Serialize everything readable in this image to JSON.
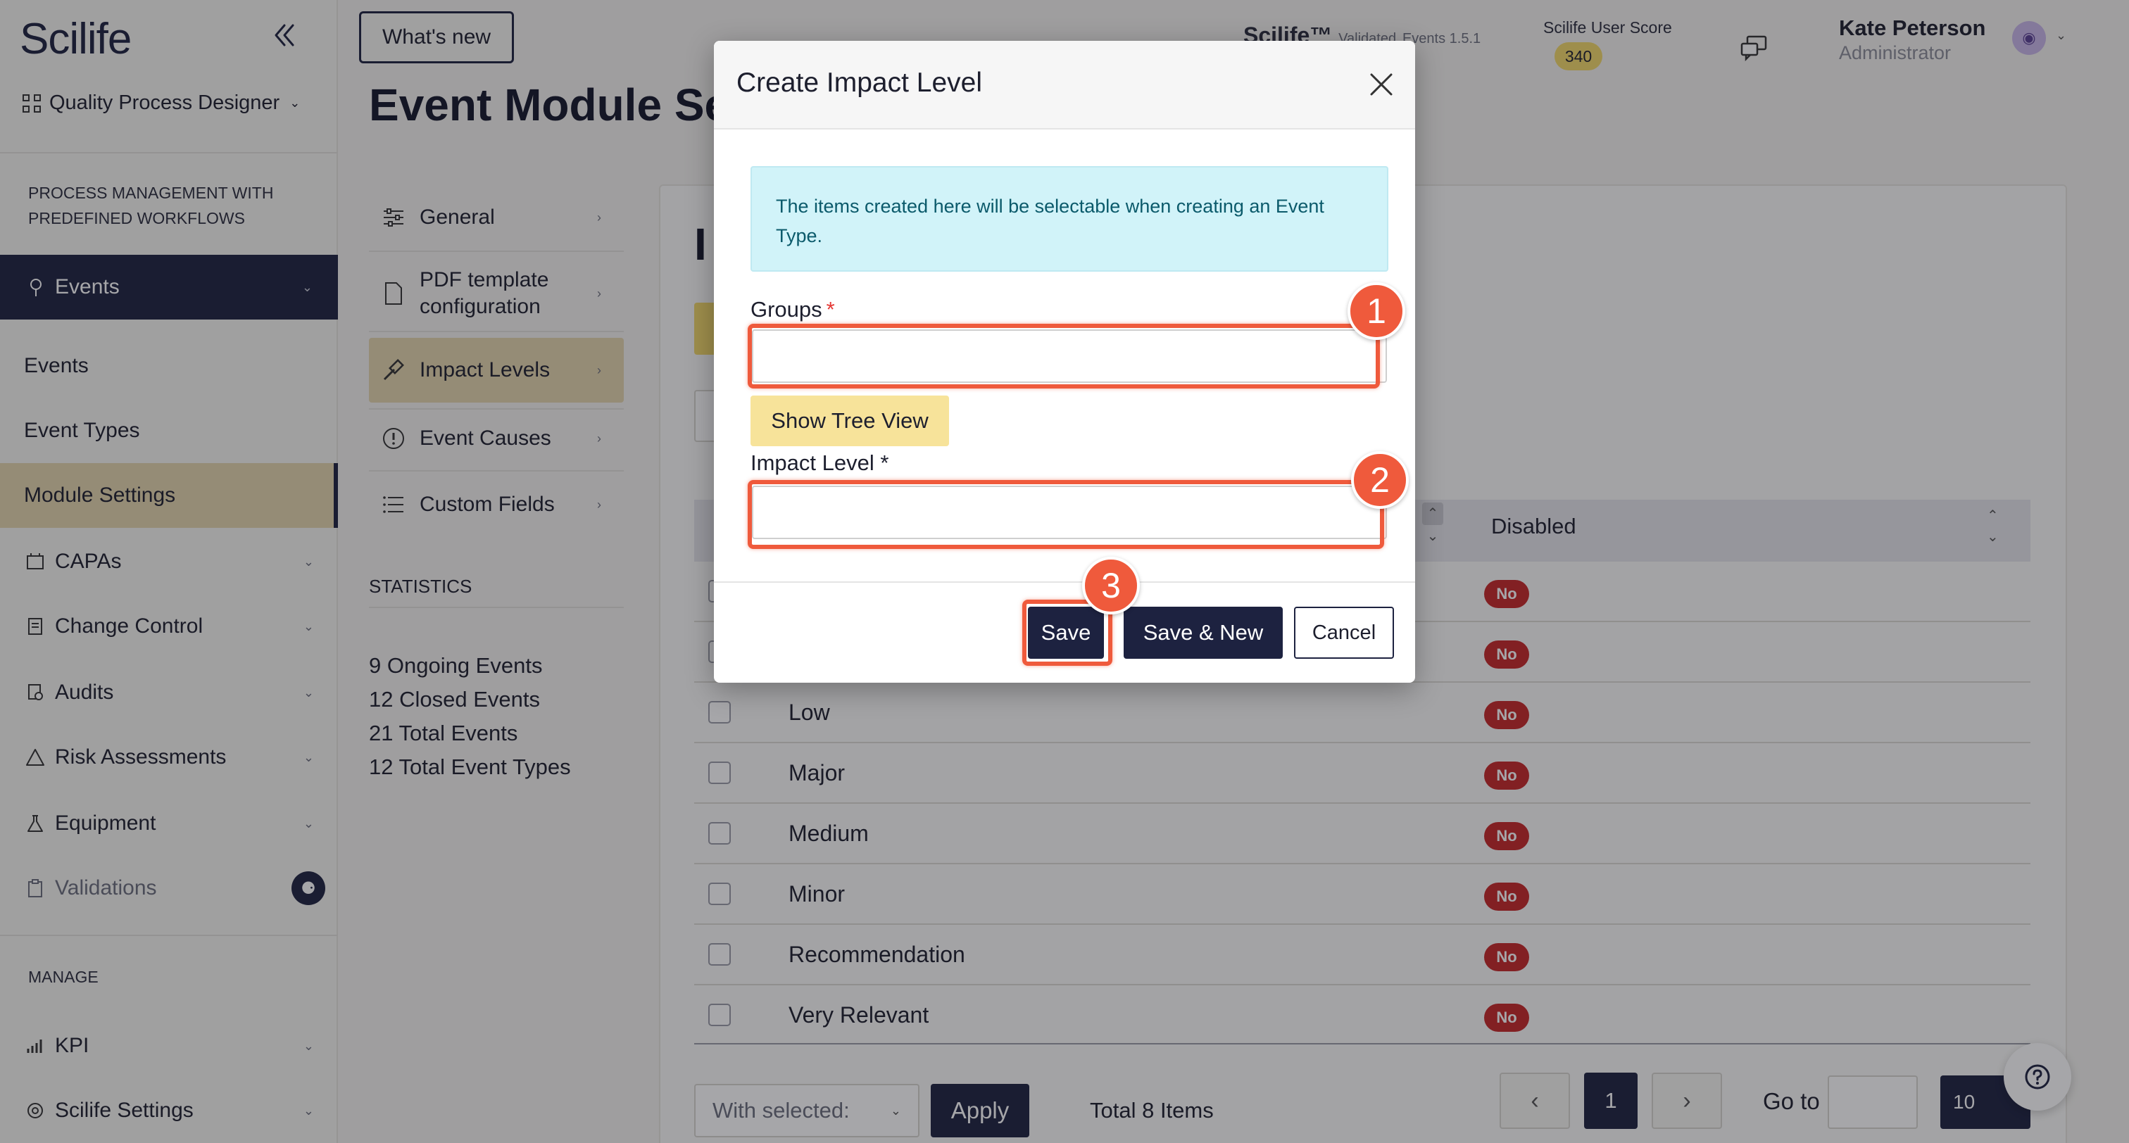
{
  "app": {
    "logo": "Scilife"
  },
  "sidebar": {
    "module_selector": "Quality Process Designer",
    "section_process": "PROCESS MANAGEMENT WITH PREDEFINED WORKFLOWS",
    "events_group": "Events",
    "items": [
      {
        "label": "Events"
      },
      {
        "label": "Event Types"
      },
      {
        "label": "Module Settings",
        "active": true
      },
      {
        "label": "CAPAs"
      },
      {
        "label": "Change Control"
      },
      {
        "label": "Audits"
      },
      {
        "label": "Risk Assessments"
      },
      {
        "label": "Equipment"
      },
      {
        "label": "Validations"
      }
    ],
    "section_manage": "MANAGE",
    "manage_items": [
      {
        "label": "KPI"
      },
      {
        "label": "Scilife Settings"
      }
    ]
  },
  "header": {
    "whats_new": "What's new",
    "page_title": "Event Module Se",
    "brand": "Scilife™",
    "validated": "Validated",
    "version": "Events 1.5.1",
    "score_label": "Scilife User Score",
    "score_value": "340",
    "user_name": "Kate Peterson",
    "user_role": "Administrator"
  },
  "subnav": {
    "items": [
      {
        "label": "General"
      },
      {
        "label": "PDF template configuration"
      },
      {
        "label": "Impact Levels",
        "active": true
      },
      {
        "label": "Event Causes"
      },
      {
        "label": "Custom Fields"
      }
    ],
    "statistics_label": "STATISTICS",
    "stats": [
      "9 Ongoing Events",
      "12 Closed Events",
      "21 Total Events",
      "12 Total Event Types"
    ]
  },
  "main": {
    "heading_peek": "I",
    "table": {
      "column_disabled": "Disabled",
      "rows": [
        {
          "name": "",
          "disabled": "No"
        },
        {
          "name": "",
          "disabled": "No"
        },
        {
          "name": "Low",
          "disabled": "No"
        },
        {
          "name": "Major",
          "disabled": "No"
        },
        {
          "name": "Medium",
          "disabled": "No"
        },
        {
          "name": "Minor",
          "disabled": "No"
        },
        {
          "name": "Recommendation",
          "disabled": "No"
        },
        {
          "name": "Very Relevant",
          "disabled": "No"
        }
      ]
    },
    "footer": {
      "with_selected": "With selected:",
      "apply": "Apply",
      "total": "Total 8 Items",
      "current_page": "1",
      "go_to": "Go to",
      "page_size": "10"
    }
  },
  "modal": {
    "title": "Create Impact Level",
    "info": "The items created here will be selectable when creating an Event Type.",
    "groups_label": "Groups",
    "groups_value": "",
    "show_tree_view": "Show Tree View",
    "impact_level_label": "Impact Level *",
    "impact_level_value": "",
    "save": "Save",
    "save_new": "Save & New",
    "cancel": "Cancel"
  },
  "annotations": [
    {
      "number": "1",
      "target": "groups-field"
    },
    {
      "number": "2",
      "target": "impact-level-field"
    },
    {
      "number": "3",
      "target": "save-button"
    }
  ],
  "colors": {
    "navy": "#1d2240",
    "accent_tan": "#e4d5ad",
    "tree_button": "#f7e39a",
    "info_box": "#d1f3f9",
    "badge_red": "#c62828",
    "annotation": "#ef5a3c"
  }
}
